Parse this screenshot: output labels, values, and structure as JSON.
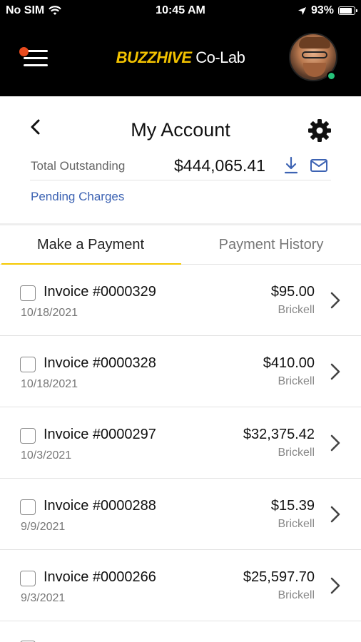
{
  "status_bar": {
    "carrier": "No SIM",
    "time": "10:45 AM",
    "battery": "93%"
  },
  "header": {
    "brand_main": "BUZZHIVE",
    "brand_sub": " Co-Lab"
  },
  "account": {
    "title": "My Account",
    "total_label": "Total Outstanding",
    "total_amount": "$444,065.41",
    "pending_link": "Pending Charges"
  },
  "tabs": {
    "make_payment": "Make a Payment",
    "payment_history": "Payment History"
  },
  "invoices": [
    {
      "number": "Invoice #0000329",
      "date": "10/18/2021",
      "amount": "$95.00",
      "location": "Brickell"
    },
    {
      "number": "Invoice #0000328",
      "date": "10/18/2021",
      "amount": "$410.00",
      "location": "Brickell"
    },
    {
      "number": "Invoice #0000297",
      "date": "10/3/2021",
      "amount": "$32,375.42",
      "location": "Brickell"
    },
    {
      "number": "Invoice #0000288",
      "date": "9/9/2021",
      "amount": "$15.39",
      "location": "Brickell"
    },
    {
      "number": "Invoice #0000266",
      "date": "9/3/2021",
      "amount": "$25,597.70",
      "location": "Brickell"
    }
  ],
  "colors": {
    "brand_yellow": "#f2c200",
    "accent_blue": "#3d63b3",
    "online_green": "#26c27a",
    "notification_red": "#e94b1e"
  }
}
